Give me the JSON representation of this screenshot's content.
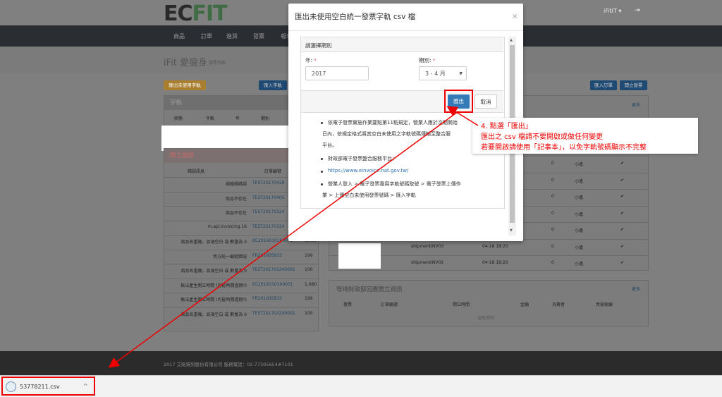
{
  "header": {
    "logo_ec": "EC",
    "logo_fit": "FIT",
    "user": "iFitIT ▾",
    "logout_icon": "⇥"
  },
  "nav": [
    "商品",
    "訂單",
    "進貨",
    "發票",
    "報表"
  ],
  "page": {
    "title": "iFit 愛瘦身",
    "subtitle": "發票列表"
  },
  "toolbar": {
    "export_unused": "匯出未使用字軌",
    "import_track": "匯入字軌",
    "import_order": "匯入訂單",
    "issue_invoice": "開立發票"
  },
  "track_panel": {
    "title": "字軌",
    "headers": [
      "狀態",
      "字軌",
      "年",
      "期別"
    ]
  },
  "issue_error_panel": {
    "title": "開立錯誤",
    "headers": [
      "錯誤訊息",
      "訂單編號"
    ],
    "rows": [
      {
        "msg": "捐贈碼錯誤",
        "order": "TEST20170428",
        "amt": ""
      },
      {
        "msg": "商品不存在",
        "order": "TEST20170405",
        "amt": ""
      },
      {
        "msg": "商品不存在",
        "order": "TEST20170324",
        "amt": ""
      },
      {
        "msg": "m.api.invoicing.16",
        "order": "TEST20170324",
        "amt": ""
      },
      {
        "msg": "商品名重複，品項空白 或 數量為 0",
        "order": "EC2016010100001",
        "amt": "1,680"
      },
      {
        "msg": "買方統一編號錯誤",
        "order": "FR201605832",
        "amt": "199"
      },
      {
        "msg": "商品名重複，品項空白 或 數量為 0",
        "order": "TEST201703240001",
        "amt": "100"
      },
      {
        "msg": "無法產生開立時間 (可能時間過期?)",
        "order": "EC2016010100001",
        "amt": "1,680"
      },
      {
        "msg": "無法產生開立時間 (可能時間過期?)",
        "order": "FR201605832",
        "amt": "199"
      },
      {
        "msg": "商品名重複，品項空白 或 數量為 0",
        "order": "TEST201703240001",
        "amt": "100"
      }
    ]
  },
  "right_panel": {
    "more": "更多",
    "rows": [
      {
        "num": "0",
        "name": "小遙",
        "check": "✔"
      },
      {
        "num": "0",
        "name": "小遙",
        "check": "✔"
      },
      {
        "num": "0",
        "name": "小遙",
        "check": "✔"
      },
      {
        "num": "0",
        "name": "小遙",
        "check": "✔"
      },
      {
        "num": "0",
        "name": "小遙",
        "check": "✔"
      },
      {
        "num": "0",
        "name": "小遙",
        "check": "✔",
        "ship": "shipmentINV03",
        "time": "04-18 18:20"
      },
      {
        "num": "0",
        "name": "小遙",
        "check": "✔",
        "ship": "shipmentINV02",
        "time": "04-18 18:20"
      }
    ]
  },
  "pending_panel": {
    "title": "等待財政部回應開立資訊",
    "more": "更多",
    "headers": [
      "發票",
      "訂單編號",
      "開立時間",
      "金額",
      "消費者",
      "買家統編"
    ],
    "empty": "沒有資料"
  },
  "modal": {
    "title": "匯出未使用空白統一發票字軌 csv 檔",
    "close": "×",
    "section_title": "請選擇期別",
    "year_label": "年:",
    "year_value": "2017",
    "period_label": "期別:",
    "period_value": "3 - 4 月",
    "required_mark": "*",
    "export_button": "匯出",
    "cancel_button": "取消",
    "notes": [
      "依電子發票實施作業要點第11點規定，營業人應於次期開始",
      "日內，依規定格式將其空白未使用之字軌號碼傳輸至整合服",
      "平台。",
      "財政部電子發票整合服務平台：",
      "https://www.einvoice.nat.gov.tw/",
      "營業人登入 > 電子發票專用字軌號碼取號 > 電子發票上傳作",
      "業 > 上傳空白未使用發票號碼 > 匯入字軌"
    ]
  },
  "callout": {
    "line1": "4. 點選「匯出」",
    "line2": "匯出之 csv 檔請不要開啟或做任何變更",
    "line3": "若要開啟請使用「記事本」，以免字軌號碼顯示不完整"
  },
  "footer": {
    "text": "2017 艾險資訊股份有限公司 服務電話：02-77305654#7101"
  },
  "download": {
    "filename": "53778211.csv",
    "chevron": "^"
  },
  "colors": {
    "accent_red": "#ee0000",
    "primary_blue": "#337ab7",
    "warning": "#f0ad4e"
  }
}
